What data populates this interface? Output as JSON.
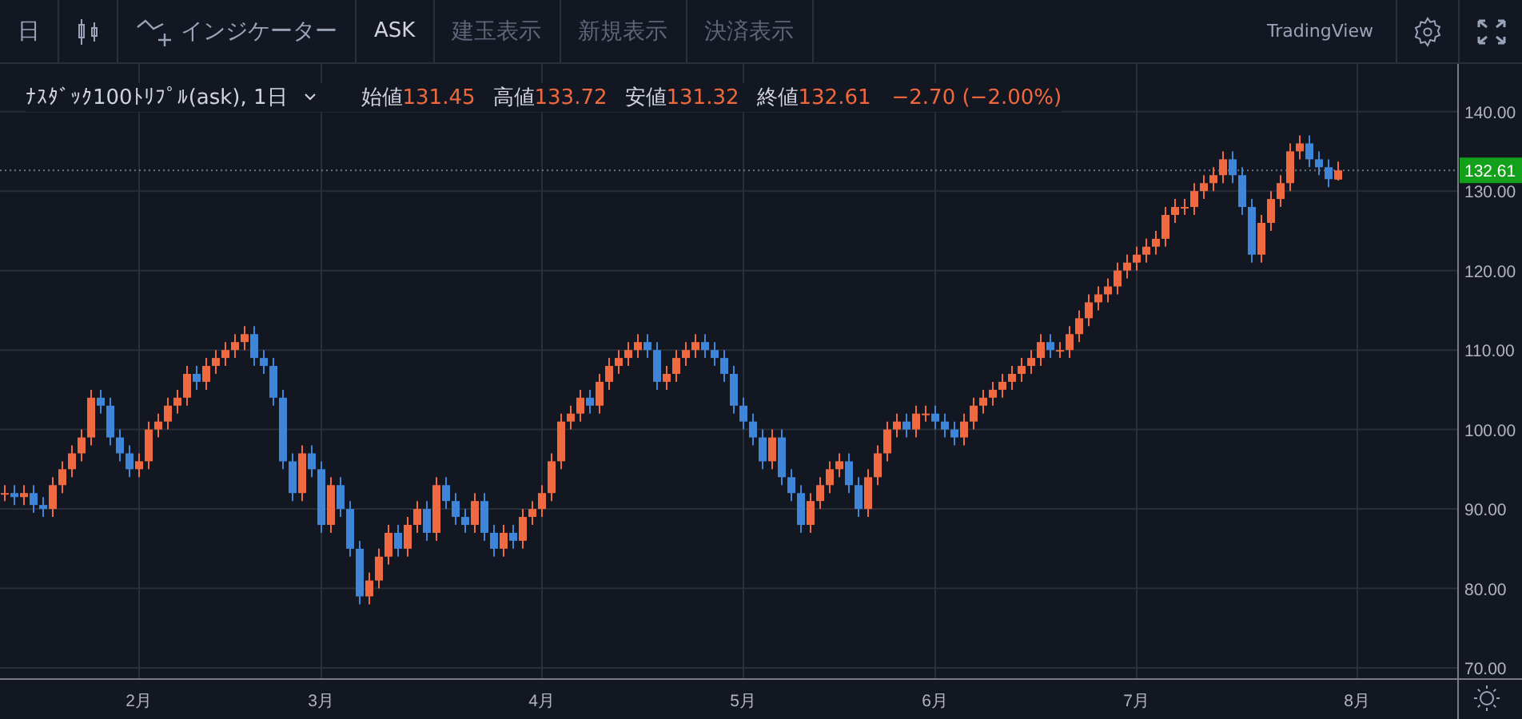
{
  "toolbar": {
    "items": [
      {
        "kind": "text",
        "label": "日",
        "disabled": false
      },
      {
        "kind": "candle-icon"
      },
      {
        "kind": "indicator",
        "label": "インジケーター",
        "disabled": false
      },
      {
        "kind": "text",
        "label": "ASK",
        "disabled": false
      },
      {
        "kind": "text",
        "label": "建玉表示",
        "disabled": true
      },
      {
        "kind": "text",
        "label": "新規表示",
        "disabled": true
      },
      {
        "kind": "text",
        "label": "決済表示",
        "disabled": true
      }
    ],
    "brand": "TradingView"
  },
  "legend": {
    "title": "ﾅｽﾀﾞｯｸ100ﾄﾘﾌﾟﾙ(ask), 1日",
    "ohlc": [
      {
        "label": "始値",
        "value": "131.45"
      },
      {
        "label": "高値",
        "value": "133.72"
      },
      {
        "label": "安値",
        "value": "131.32"
      },
      {
        "label": "終値",
        "value": "132.61"
      }
    ],
    "change": "−2.70 (−2.00%)"
  },
  "chart": {
    "chart_data": {
      "type": "candlestick",
      "grid": true,
      "ylim": [
        68.6,
        146
      ],
      "yticks": [
        {
          "value": 70,
          "label": "70.00"
        },
        {
          "value": 80,
          "label": "80.00"
        },
        {
          "value": 90,
          "label": "90.00"
        },
        {
          "value": 100,
          "label": "100.00"
        },
        {
          "value": 110,
          "label": "110.00"
        },
        {
          "value": 120,
          "label": "120.00"
        },
        {
          "value": 130,
          "label": "130.00"
        },
        {
          "value": 140,
          "label": "140.00"
        }
      ],
      "ref_lines": [
        {
          "axis": "y",
          "value": 132.61,
          "label": "132.61"
        }
      ],
      "categories": [
        null,
        null,
        null,
        null,
        null,
        null,
        null,
        null,
        null,
        null,
        null,
        null,
        null,
        null,
        "2月",
        null,
        null,
        null,
        null,
        null,
        null,
        null,
        null,
        null,
        null,
        null,
        null,
        null,
        null,
        null,
        null,
        null,
        null,
        "3月",
        null,
        null,
        null,
        null,
        null,
        null,
        null,
        null,
        null,
        null,
        null,
        null,
        null,
        null,
        null,
        null,
        null,
        null,
        null,
        null,
        null,
        null,
        "4月",
        null,
        null,
        null,
        null,
        null,
        null,
        null,
        null,
        null,
        null,
        null,
        null,
        null,
        null,
        null,
        null,
        null,
        null,
        null,
        null,
        "5月",
        null,
        null,
        null,
        null,
        null,
        null,
        null,
        null,
        null,
        null,
        null,
        null,
        null,
        null,
        null,
        null,
        null,
        null,
        null,
        "6月",
        null,
        null,
        null,
        null,
        null,
        null,
        null,
        null,
        null,
        null,
        null,
        null,
        null,
        null,
        null,
        null,
        null,
        null,
        null,
        null,
        "7月",
        null,
        null,
        null,
        null,
        null,
        null,
        null,
        null,
        null,
        null,
        null,
        null,
        null,
        null,
        null,
        null,
        null,
        null,
        null,
        null,
        null,
        null,
        "8月",
        null,
        null,
        null,
        null,
        null,
        null,
        null,
        null,
        null,
        null
      ],
      "ohlc": [
        [
          92,
          93,
          91,
          92
        ],
        [
          92,
          93,
          90.5,
          91.5
        ],
        [
          91.5,
          93,
          90.5,
          92
        ],
        [
          92,
          93,
          89.5,
          90.5
        ],
        [
          90.5,
          91.5,
          89,
          90
        ],
        [
          90,
          94,
          89,
          93
        ],
        [
          93,
          96,
          92,
          95
        ],
        [
          95,
          98,
          94,
          97
        ],
        [
          97,
          100,
          96,
          99
        ],
        [
          99,
          105,
          98,
          104
        ],
        [
          104,
          105,
          102,
          103
        ],
        [
          103,
          104,
          98,
          99
        ],
        [
          99,
          100,
          96,
          97
        ],
        [
          97,
          98,
          94,
          95
        ],
        [
          95,
          97,
          94,
          96
        ],
        [
          96,
          101,
          95,
          100
        ],
        [
          100,
          102,
          99,
          101
        ],
        [
          101,
          104,
          100,
          103
        ],
        [
          103,
          105,
          102,
          104
        ],
        [
          104,
          108,
          103,
          107
        ],
        [
          107,
          108,
          105,
          106
        ],
        [
          106,
          109,
          105,
          108
        ],
        [
          108,
          110,
          107,
          109
        ],
        [
          109,
          111,
          108,
          110
        ],
        [
          110,
          112,
          109,
          111
        ],
        [
          111,
          113,
          110,
          112
        ],
        [
          112,
          113,
          108,
          109
        ],
        [
          109,
          110,
          107,
          108
        ],
        [
          108,
          109,
          103,
          104
        ],
        [
          104,
          105,
          95,
          96
        ],
        [
          96,
          97,
          91,
          92
        ],
        [
          92,
          98,
          91,
          97
        ],
        [
          97,
          98,
          94,
          95
        ],
        [
          95,
          96,
          87,
          88
        ],
        [
          88,
          94,
          87,
          93
        ],
        [
          93,
          94,
          89,
          90
        ],
        [
          90,
          91,
          84,
          85
        ],
        [
          85,
          86,
          78,
          79
        ],
        [
          79,
          82,
          78,
          81
        ],
        [
          81,
          85,
          80,
          84
        ],
        [
          84,
          88,
          83,
          87
        ],
        [
          87,
          88,
          84,
          85
        ],
        [
          85,
          89,
          84,
          88
        ],
        [
          88,
          91,
          87,
          90
        ],
        [
          90,
          91,
          86,
          87
        ],
        [
          87,
          94,
          86,
          93
        ],
        [
          93,
          94,
          90,
          91
        ],
        [
          91,
          92,
          88,
          89
        ],
        [
          89,
          90,
          87,
          88
        ],
        [
          88,
          92,
          87,
          91
        ],
        [
          91,
          92,
          86,
          87
        ],
        [
          87,
          88,
          84,
          85
        ],
        [
          85,
          88,
          84,
          87
        ],
        [
          87,
          88,
          85,
          86
        ],
        [
          86,
          90,
          85,
          89
        ],
        [
          89,
          91,
          88,
          90
        ],
        [
          90,
          93,
          89,
          92
        ],
        [
          92,
          97,
          91,
          96
        ],
        [
          96,
          102,
          95,
          101
        ],
        [
          101,
          103,
          100,
          102
        ],
        [
          102,
          105,
          101,
          104
        ],
        [
          104,
          105,
          102,
          103
        ],
        [
          103,
          107,
          102,
          106
        ],
        [
          106,
          109,
          105,
          108
        ],
        [
          108,
          110,
          107,
          109
        ],
        [
          109,
          111,
          108,
          110
        ],
        [
          110,
          112,
          109,
          111
        ],
        [
          111,
          112,
          109,
          110
        ],
        [
          110,
          111,
          105,
          106
        ],
        [
          106,
          108,
          105,
          107
        ],
        [
          107,
          110,
          106,
          109
        ],
        [
          109,
          111,
          108,
          110
        ],
        [
          110,
          112,
          109,
          111
        ],
        [
          111,
          112,
          109,
          110
        ],
        [
          110,
          111,
          108,
          109
        ],
        [
          109,
          110,
          106,
          107
        ],
        [
          107,
          108,
          102,
          103
        ],
        [
          103,
          104,
          100,
          101
        ],
        [
          101,
          102,
          98,
          99
        ],
        [
          99,
          100,
          95,
          96
        ],
        [
          96,
          100,
          95,
          99
        ],
        [
          99,
          100,
          93,
          94
        ],
        [
          94,
          95,
          91,
          92
        ],
        [
          92,
          93,
          87,
          88
        ],
        [
          88,
          92,
          87,
          91
        ],
        [
          91,
          94,
          90,
          93
        ],
        [
          93,
          96,
          92,
          95
        ],
        [
          95,
          97,
          94,
          96
        ],
        [
          96,
          97,
          92,
          93
        ],
        [
          93,
          94,
          89,
          90
        ],
        [
          90,
          95,
          89,
          94
        ],
        [
          94,
          98,
          93,
          97
        ],
        [
          97,
          101,
          96,
          100
        ],
        [
          100,
          102,
          99,
          101
        ],
        [
          101,
          102,
          99,
          100
        ],
        [
          100,
          103,
          99,
          102
        ],
        [
          102,
          103,
          101,
          102
        ],
        [
          102,
          103,
          100,
          101
        ],
        [
          101,
          102,
          99,
          100
        ],
        [
          100,
          101,
          98,
          99
        ],
        [
          99,
          102,
          98,
          101
        ],
        [
          101,
          104,
          100,
          103
        ],
        [
          103,
          105,
          102,
          104
        ],
        [
          104,
          106,
          103,
          105
        ],
        [
          105,
          107,
          104,
          106
        ],
        [
          106,
          108,
          105,
          107
        ],
        [
          107,
          109,
          106,
          108
        ],
        [
          108,
          110,
          107,
          109
        ],
        [
          109,
          112,
          108,
          111
        ],
        [
          111,
          112,
          109,
          110
        ],
        [
          110,
          111,
          109,
          110
        ],
        [
          110,
          113,
          109,
          112
        ],
        [
          112,
          115,
          111,
          114
        ],
        [
          114,
          117,
          113,
          116
        ],
        [
          116,
          118,
          115,
          117
        ],
        [
          117,
          119,
          116,
          118
        ],
        [
          118,
          121,
          117,
          120
        ],
        [
          120,
          122,
          119,
          121
        ],
        [
          121,
          123,
          120,
          122
        ],
        [
          122,
          124,
          121,
          123
        ],
        [
          123,
          125,
          122,
          124
        ],
        [
          124,
          128,
          123,
          127
        ],
        [
          127,
          129,
          126,
          128
        ],
        [
          128,
          129,
          127,
          128
        ],
        [
          128,
          131,
          127,
          130
        ],
        [
          130,
          132,
          129,
          131
        ],
        [
          131,
          133,
          130,
          132
        ],
        [
          132,
          135,
          131,
          134
        ],
        [
          134,
          135,
          131,
          132
        ],
        [
          132,
          133,
          127,
          128
        ],
        [
          128,
          129,
          121,
          122
        ],
        [
          122,
          127,
          121,
          126
        ],
        [
          126,
          130,
          125,
          129
        ],
        [
          129,
          132,
          128,
          131
        ],
        [
          131,
          136,
          130,
          135
        ],
        [
          135,
          137,
          134,
          136
        ],
        [
          136,
          137,
          133,
          134
        ],
        [
          134,
          135,
          132,
          133
        ],
        [
          133,
          134,
          130.5,
          131.5
        ],
        [
          131.45,
          133.72,
          131.32,
          132.61
        ],
        null,
        null,
        null,
        null,
        null,
        null,
        null,
        null,
        null,
        null,
        null,
        null
      ]
    }
  }
}
